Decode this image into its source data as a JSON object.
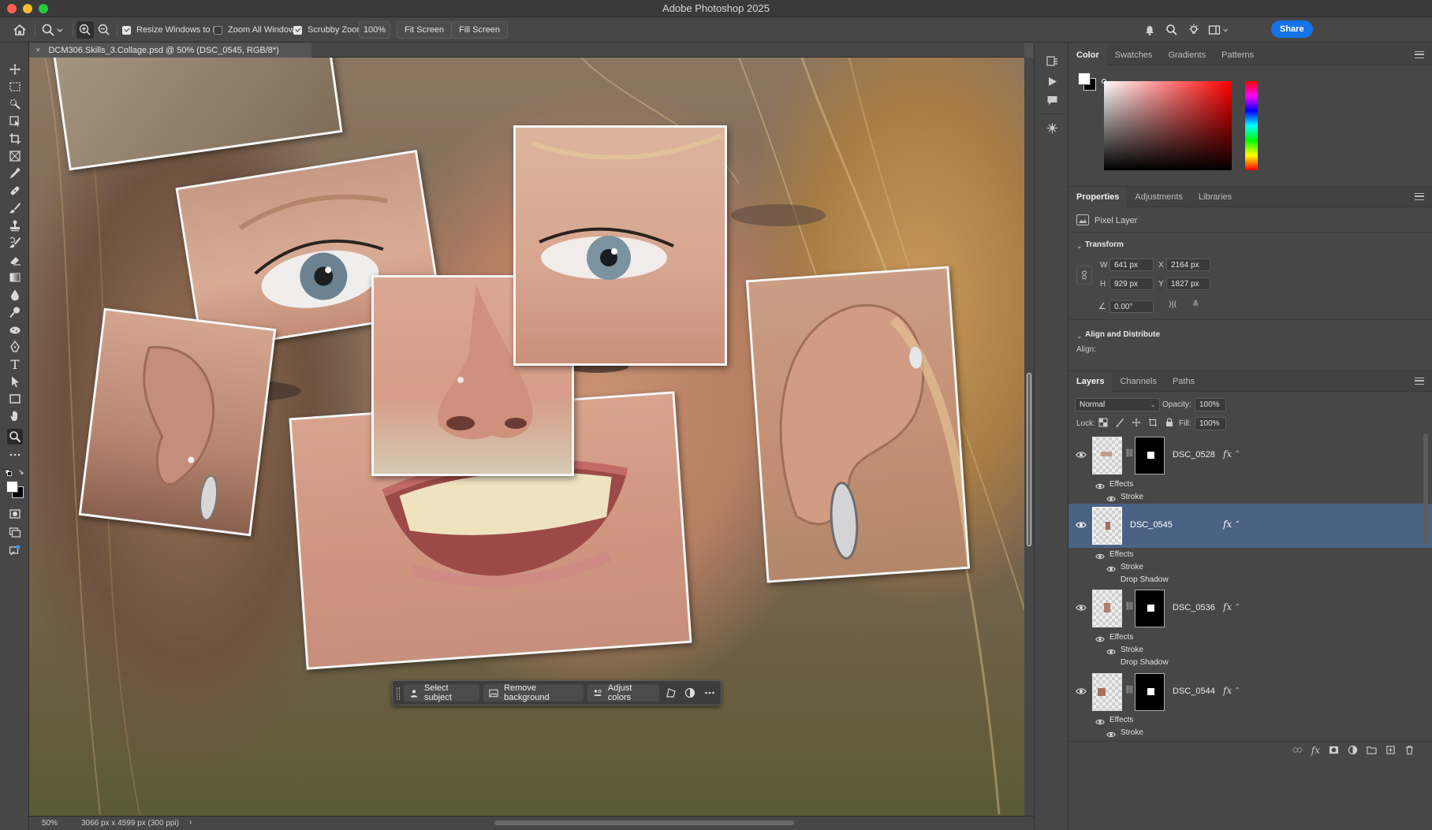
{
  "window": {
    "title": "Adobe Photoshop 2025"
  },
  "options_bar": {
    "resize_windows": {
      "label": "Resize Windows to Fit",
      "checked": true
    },
    "zoom_all": {
      "label": "Zoom All Windows",
      "checked": false
    },
    "scrubby": {
      "label": "Scrubby Zoom",
      "checked": true
    },
    "zoom_value": "100%",
    "fit_screen": "Fit Screen",
    "fill_screen": "Fill Screen",
    "share": "Share"
  },
  "document": {
    "tab_title": "DCM306.Skills_3.Collage.psd @ 50% (DSC_0545, RGB/8*)",
    "close_glyph": "×"
  },
  "status": {
    "zoom": "50%",
    "dimensions": "3066 px x 4599 px (300 ppi)",
    "arrow": "›"
  },
  "contextual_bar": {
    "select_subject": "Select subject",
    "remove_background": "Remove background",
    "adjust_colors": "Adjust colors"
  },
  "color_panel": {
    "tabs": [
      "Color",
      "Swatches",
      "Gradients",
      "Patterns"
    ],
    "hue": "#ff0000"
  },
  "properties_panel": {
    "tabs": [
      "Properties",
      "Adjustments",
      "Libraries"
    ],
    "layer_type": "Pixel Layer",
    "transform_title": "Transform",
    "w_label": "W",
    "w_value": "641 px",
    "h_label": "H",
    "h_value": "929 px",
    "x_label": "X",
    "x_value": "2164 px",
    "y_label": "Y",
    "y_value": "1827 px",
    "angle": "0.00°",
    "align_title": "Align and Distribute",
    "align_label": "Align:"
  },
  "layers_panel": {
    "tabs": [
      "Layers",
      "Channels",
      "Paths"
    ],
    "blend_mode": "Normal",
    "opacity_label": "Opacity:",
    "opacity": "100%",
    "lock_label": "Lock:",
    "fill_label": "Fill:",
    "fill": "100%",
    "layers": [
      {
        "name": "DSC_0528",
        "effects_label": "Effects",
        "effects": [
          "Stroke"
        ],
        "selected": false
      },
      {
        "name": "DSC_0545",
        "effects_label": "Effects",
        "effects": [
          "Stroke",
          "Drop Shadow"
        ],
        "selected": true
      },
      {
        "name": "DSC_0536",
        "effects_label": "Effects",
        "effects": [
          "Stroke",
          "Drop Shadow"
        ],
        "selected": false
      },
      {
        "name": "DSC_0544",
        "effects_label": "Effects",
        "effects": [
          "Stroke"
        ],
        "selected": false
      }
    ],
    "fx_glyph": "fx"
  },
  "colors": {
    "accent": "#1473e6",
    "selected_layer": "#4b6284",
    "panel_bg": "#474747"
  }
}
